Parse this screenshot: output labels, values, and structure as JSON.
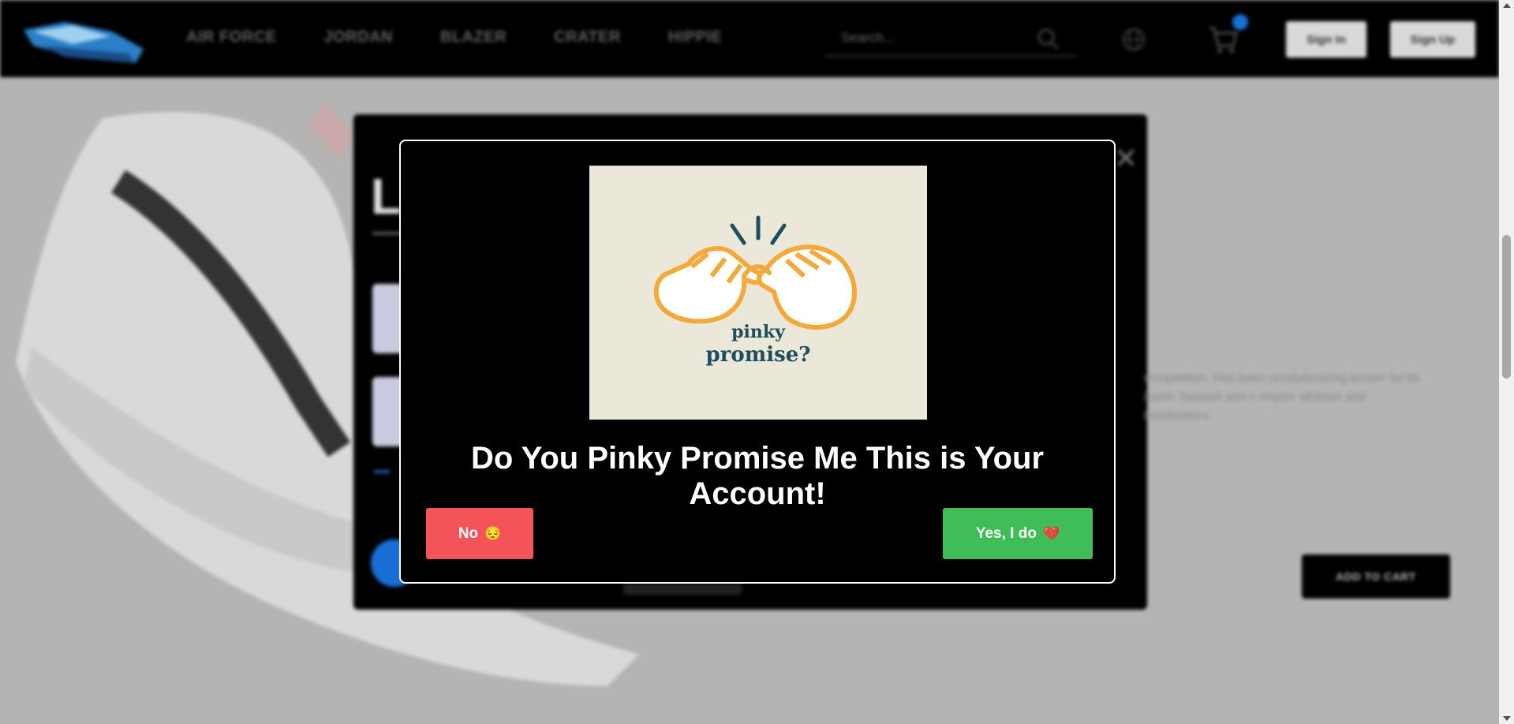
{
  "nav": {
    "links": [
      "AIR FORCE",
      "JORDAN",
      "BLAZER",
      "CRATER",
      "HIPPIE"
    ],
    "search_placeholder": "Search...",
    "sign_in": "Sign In",
    "sign_up": "Sign Up"
  },
  "product": {
    "title_fragment": "L",
    "description": "competition. Has been revolutionizing known for its iconic Swoosh and o inspire athletes and trendsetters.",
    "add_to_cart": "ADD TO CART"
  },
  "modal": {
    "image_text_line1": "pinky",
    "image_text_line2": "promise?",
    "title": "Do You Pinky Promise Me This is Your Account!",
    "no_label": "No",
    "no_emoji": "😔",
    "yes_label": "Yes, I do",
    "yes_emoji": "💔"
  },
  "colors": {
    "no_button": "#f25459",
    "yes_button": "#3fbd57",
    "image_bg": "#ebe8d9",
    "hand_orange": "#f4a93b",
    "text_teal": "#1d4e5f"
  }
}
